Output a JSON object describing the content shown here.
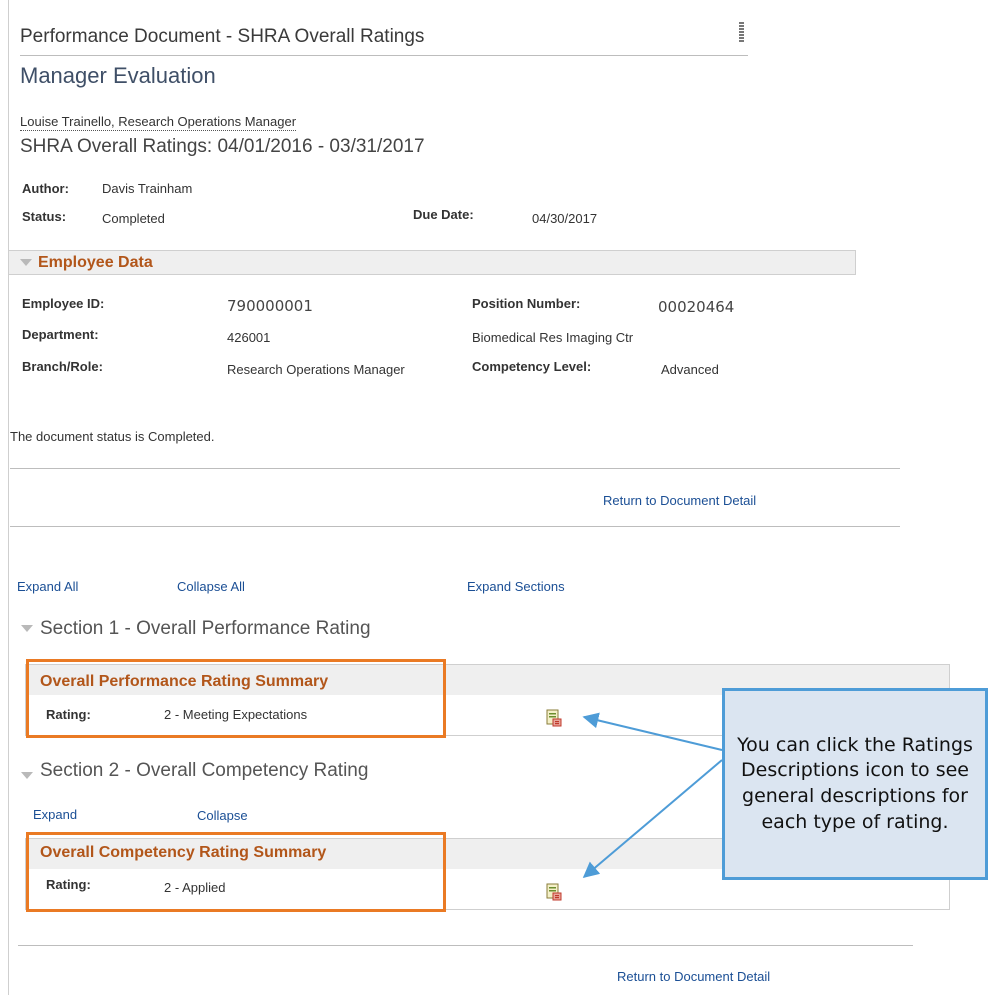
{
  "header": {
    "doc_title": "Performance Document - SHRA Overall Ratings",
    "subtitle": "Manager Evaluation",
    "employee_line": "Louise Trainello, Research Operations Manager",
    "period": "SHRA Overall Ratings: 04/01/2016 - 03/31/2017",
    "author_label": "Author:",
    "author_value": "Davis Trainham",
    "status_label": "Status:",
    "status_value": "Completed",
    "due_label": "Due Date:",
    "due_value": "04/30/2017"
  },
  "employee_data": {
    "title": "Employee Data",
    "emp_id_label": "Employee ID:",
    "emp_id_value": "790000001",
    "position_label": "Position Number:",
    "position_value": "00020464",
    "dept_label": "Department:",
    "dept_value": "426001",
    "dept_name": "Biomedical Res Imaging Ctr",
    "branch_label": "Branch/Role:",
    "branch_value": "Research Operations Manager",
    "competency_label": "Competency Level:",
    "competency_value": "Advanced"
  },
  "status_message": "The document status is Completed.",
  "links": {
    "return_top": "Return to Document Detail",
    "expand_all": "Expand All",
    "collapse_all": "Collapse All",
    "expand_sections": "Expand Sections",
    "expand": "Expand",
    "collapse": "Collapse",
    "return_bottom": "Return to Document Detail"
  },
  "section1": {
    "title": "Section 1 - Overall Performance Rating",
    "summary_title": "Overall Performance Rating Summary",
    "rating_label": "Rating:",
    "rating_value": "2 - Meeting Expectations"
  },
  "section2": {
    "title": "Section 2 - Overall Competency Rating",
    "summary_title": "Overall Competency Rating Summary",
    "rating_label": "Rating:",
    "rating_value": "2 - Applied"
  },
  "callout": {
    "text": "You can click the Ratings Descriptions icon to see general descriptions for each type of rating."
  },
  "colors": {
    "accent_orange": "#ea7a24",
    "section_title_brown": "#b2561a",
    "link_blue": "#1b4f95",
    "callout_fill": "#dbe5f1",
    "callout_border": "#4e9cd7"
  },
  "icons": {
    "ratings_descriptions": "ratings-descriptions-icon",
    "collapse_triangle": "triangle-down-icon"
  }
}
